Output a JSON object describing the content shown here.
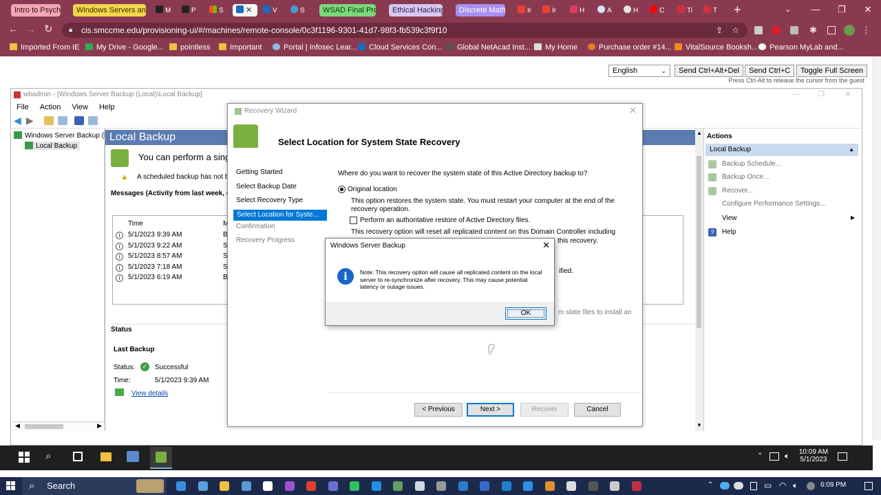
{
  "browser": {
    "tabs": [
      {
        "label": "Intro to Psych",
        "color": "#f2a6b4",
        "text": "#3a0a14"
      },
      {
        "label": "Windows Servers and",
        "color": "#f4d54a",
        "text": "#3a2a00"
      },
      {
        "label": "WSAD Final Proj",
        "color": "#7cd87c",
        "text": "#0a3a0a"
      },
      {
        "label": "Ethical Hacking",
        "color": "#d8c8f0",
        "text": "#2a1a4a"
      },
      {
        "label": "Discrete Math",
        "color": "#a98ff0",
        "text": "#ffffff"
      }
    ],
    "mini_tabs": [
      "M",
      "P",
      "S",
      "V",
      "S",
      "Ir",
      "Ir",
      "H",
      "A",
      "H",
      "C",
      "Ti",
      "T"
    ],
    "url": "cis.smccme.edu/provisioning-ui/#/machines/remote-console/0c3f1196-9301-41d7-98f3-fb539c3f9f10",
    "bookmarks": [
      "Imported From IE",
      "My Drive - Google...",
      "pointless",
      "Important",
      "Portal | Infosec Lear...",
      "Cloud Services Con...",
      "Global NetAcad Inst...",
      "My Home",
      "Purchase order #14...",
      "VitalSource Booksh...",
      "Pearson MyLab and..."
    ]
  },
  "vm": {
    "language": "English",
    "send_cad": "Send Ctrl+Alt+Del",
    "send_cc": "Send Ctrl+C",
    "fullscreen": "Toggle Full Screen",
    "hint": "Press Ctrl-Alt to release the cursor from the guest"
  },
  "wbadmin": {
    "title": "wbadmin - [Windows Server Backup (Local)\\Local Backup]",
    "menu": [
      "File",
      "Action",
      "View",
      "Help"
    ],
    "tree_root": "Windows Server Backup (l",
    "tree_child": "Local Backup",
    "header": "Local Backup",
    "intro": "You can perform a sing",
    "warning": "A scheduled backup has not be",
    "messages_title": "Messages (Activity from last week, d",
    "time_header": "Time",
    "col2_header": "M",
    "messages": [
      {
        "time": "5/1/2023 9:39 AM",
        "m": "Ba"
      },
      {
        "time": "5/1/2023 9:22 AM",
        "m": "Sy"
      },
      {
        "time": "5/1/2023 8:57 AM",
        "m": "Sy"
      },
      {
        "time": "5/1/2023 7:18 AM",
        "m": "Sy"
      },
      {
        "time": "5/1/2023 6:19 AM",
        "m": "Ba"
      }
    ],
    "status_title": "Status",
    "last_backup": "Last Backup",
    "status_label": "Status:",
    "status_value": "Successful",
    "time_label": "Time:",
    "time_value": "5/1/2023 9:39 AM",
    "view_details": "View details",
    "actions_title": "Actions",
    "actions_section": "Local Backup",
    "actions": [
      "Backup Schedule...",
      "Backup Once...",
      "Recover...",
      "Configure Performance Settings...",
      "View",
      "Help"
    ]
  },
  "wizard": {
    "title": "Recovery Wizard",
    "heading": "Select Location for System State Recovery",
    "nav": [
      "Getting Started",
      "Select Backup Date",
      "Select Recovery Type",
      "Select Location for Syste...",
      "Confirmation",
      "Recovery Progress"
    ],
    "question": "Where do you want to recover the system state of this Active Directory backup to?",
    "original_location": "Original location",
    "original_desc": "This option restores the system state. You must restart your computer at the end of the recovery operation.",
    "authoritative": "Perform an authoritative restore of Active Directory files.",
    "reset_desc": "This recovery option will reset all replicated content on this Domain Controller including",
    "reset_desc_tail": "this recovery.",
    "hidden_frag1": "ified.",
    "hidden_frag2": "m state files to install an",
    "btn_previous": "< Previous",
    "btn_next": "Next >",
    "btn_recover": "Recover",
    "btn_cancel": "Cancel"
  },
  "msgbox": {
    "title": "Windows Server Backup",
    "text": "Note: This recovery option will cause all replicated content on the local server to re-synchronize after recovery. This may cause potential latency or outage issues.",
    "ok": "OK"
  },
  "guest_taskbar": {
    "time": "10:09 AM",
    "date": "5/1/2023"
  },
  "host_taskbar": {
    "search": "Search",
    "time": "6:09 PM"
  }
}
